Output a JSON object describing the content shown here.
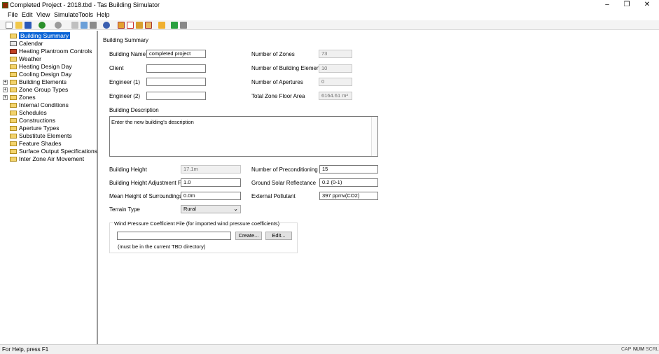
{
  "window": {
    "title": "Completed Project - 2018.tbd - Tas Building Simulator",
    "minimize_glyph": "–",
    "restore_glyph": "❐",
    "close_glyph": "✕"
  },
  "menu": [
    "File",
    "Edit",
    "View",
    "Simulate",
    "Tools",
    "Help"
  ],
  "tree": {
    "items": [
      {
        "label": "Building Summary",
        "selected": true
      },
      {
        "label": "Calendar"
      },
      {
        "label": "Heating Plantroom Controls"
      },
      {
        "label": "Weather"
      },
      {
        "label": "Heating Design Day"
      },
      {
        "label": "Cooling Design Day"
      },
      {
        "label": "Building Elements",
        "expander": "+"
      },
      {
        "label": "Zone Group Types",
        "expander": "+"
      },
      {
        "label": "Zones",
        "expander": "+"
      },
      {
        "label": "Internal Conditions"
      },
      {
        "label": "Schedules"
      },
      {
        "label": "Constructions"
      },
      {
        "label": "Aperture Types"
      },
      {
        "label": "Substitute Elements"
      },
      {
        "label": "Feature Shades"
      },
      {
        "label": "Surface Output Specifications"
      },
      {
        "label": "Inter Zone Air Movement"
      }
    ]
  },
  "summary": {
    "heading": "Building Summary",
    "building_name_label": "Building Name",
    "building_name_value": "completed project",
    "client_label": "Client",
    "client_value": "",
    "engineer1_label": "Engineer (1)",
    "engineer1_value": "",
    "engineer2_label": "Engineer (2)",
    "engineer2_value": "",
    "num_zones_label": "Number of Zones",
    "num_zones_value": "73",
    "num_elements_label": "Number of Building Elements",
    "num_elements_value": "10",
    "num_apertures_label": "Number of Apertures",
    "num_apertures_value": "0",
    "floor_area_label": "Total Zone Floor Area",
    "floor_area_value": "6164.61 m²",
    "description_label": "Building Description",
    "description_value": "Enter the new building's description",
    "height_label": "Building Height",
    "height_value": "17.1m",
    "height_factor_label": "Building Height Adjustment Factor",
    "height_factor_value": "1.0",
    "mean_height_label": "Mean Height of Surroundings",
    "mean_height_value": "0.0m",
    "terrain_label": "Terrain Type",
    "terrain_value": "Rural",
    "precond_label": "Number of Preconditioning Days",
    "precond_value": "15",
    "solar_label": "Ground Solar Reflectance",
    "solar_value": "0.2 (0-1)",
    "pollutant_label": "External Pollutant",
    "pollutant_value": "397 ppmv(CO2)",
    "wind_group_label": "Wind Pressure Coefficient File (for imported wind pressure coefficients)",
    "wind_file_value": "",
    "create_label": "Create...",
    "edit_label": "Edit...",
    "wind_note": "(must be in the current TBD directory)"
  },
  "status": {
    "help": "For Help, press F1",
    "cap": "CAP",
    "num": "NUM",
    "scrl": "SCRL"
  }
}
